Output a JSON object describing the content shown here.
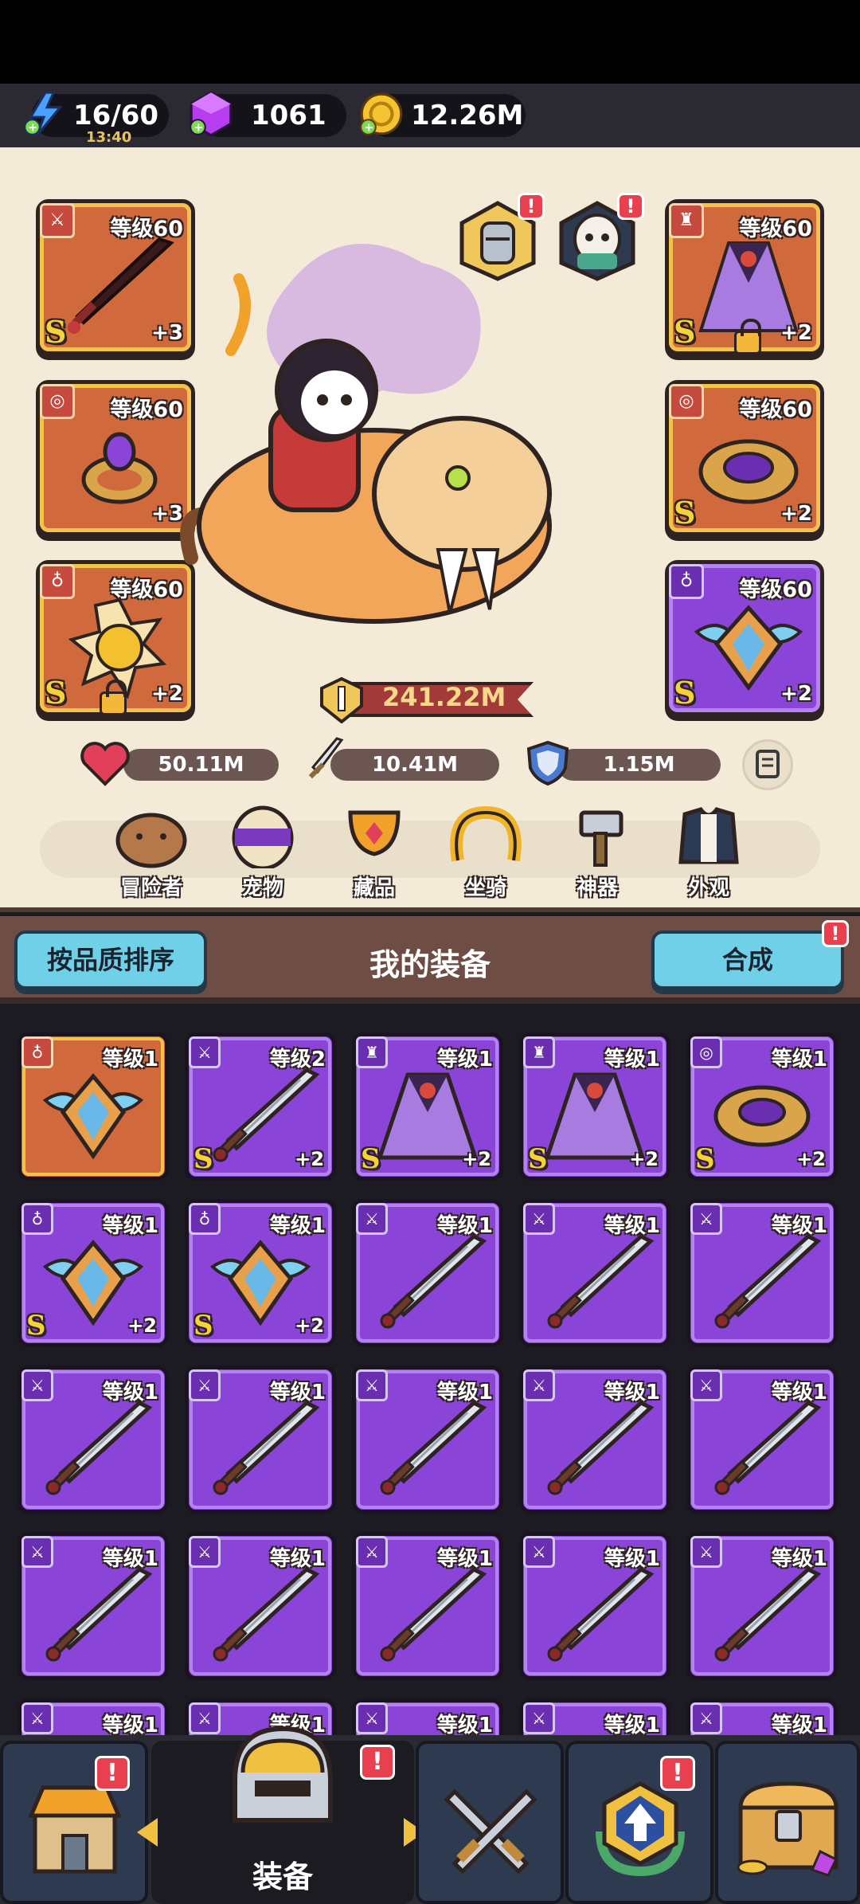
{
  "resources": {
    "energy": "16/60",
    "energy_timer": "13:40",
    "gems": "1061",
    "gold": "12.26M"
  },
  "equip_slots": [
    {
      "level": "等级60",
      "plus": "+3",
      "grade": "S",
      "type": "sword"
    },
    {
      "level": "等级60",
      "plus": "+3",
      "grade": "",
      "type": "ring"
    },
    {
      "level": "等级60",
      "plus": "+2",
      "grade": "S",
      "type": "necklace"
    },
    {
      "level": "等级60",
      "plus": "+2",
      "grade": "S",
      "type": "armor"
    },
    {
      "level": "等级60",
      "plus": "+2",
      "grade": "S",
      "type": "ring"
    },
    {
      "level": "等级60",
      "plus": "+2",
      "grade": "S",
      "type": "necklace"
    }
  ],
  "power": "241.22M",
  "stats": {
    "hp": "50.11M",
    "attack": "10.41M",
    "defense": "1.15M"
  },
  "tabs": [
    "冒险者",
    "宠物",
    "藏品",
    "坐骑",
    "神器",
    "外观"
  ],
  "toolbar": {
    "sort_label": "按品质排序",
    "title": "我的装备",
    "merge_label": "合成",
    "alert": "!"
  },
  "inventory": [
    {
      "level": "等级1",
      "plus": "",
      "grade": "",
      "type": "necklace",
      "color": "orange"
    },
    {
      "level": "等级2",
      "plus": "+2",
      "grade": "S",
      "type": "sword",
      "color": "purple"
    },
    {
      "level": "等级1",
      "plus": "+2",
      "grade": "S",
      "type": "armor",
      "color": "purple"
    },
    {
      "level": "等级1",
      "plus": "+2",
      "grade": "S",
      "type": "armor",
      "color": "purple"
    },
    {
      "level": "等级1",
      "plus": "+2",
      "grade": "S",
      "type": "ring",
      "color": "purple"
    },
    {
      "level": "等级1",
      "plus": "+2",
      "grade": "S",
      "type": "necklace",
      "color": "purple"
    },
    {
      "level": "等级1",
      "plus": "+2",
      "grade": "S",
      "type": "necklace",
      "color": "purple"
    },
    {
      "level": "等级1",
      "plus": "",
      "grade": "",
      "type": "sword",
      "color": "purple"
    },
    {
      "level": "等级1",
      "plus": "",
      "grade": "",
      "type": "sword",
      "color": "purple"
    },
    {
      "level": "等级1",
      "plus": "",
      "grade": "",
      "type": "sword",
      "color": "purple"
    },
    {
      "level": "等级1",
      "plus": "",
      "grade": "",
      "type": "sword",
      "color": "purple"
    },
    {
      "level": "等级1",
      "plus": "",
      "grade": "",
      "type": "sword",
      "color": "purple"
    },
    {
      "level": "等级1",
      "plus": "",
      "grade": "",
      "type": "sword",
      "color": "purple"
    },
    {
      "level": "等级1",
      "plus": "",
      "grade": "",
      "type": "sword",
      "color": "purple"
    },
    {
      "level": "等级1",
      "plus": "",
      "grade": "",
      "type": "sword",
      "color": "purple"
    },
    {
      "level": "等级1",
      "plus": "",
      "grade": "",
      "type": "sword",
      "color": "purple"
    },
    {
      "level": "等级1",
      "plus": "",
      "grade": "",
      "type": "sword",
      "color": "purple"
    },
    {
      "level": "等级1",
      "plus": "",
      "grade": "",
      "type": "sword",
      "color": "purple"
    },
    {
      "level": "等级1",
      "plus": "",
      "grade": "",
      "type": "sword",
      "color": "purple"
    },
    {
      "level": "等级1",
      "plus": "",
      "grade": "",
      "type": "sword",
      "color": "purple"
    },
    {
      "level": "等级1",
      "plus": "",
      "grade": "",
      "type": "sword",
      "color": "purple"
    },
    {
      "level": "等级1",
      "plus": "",
      "grade": "",
      "type": "sword",
      "color": "purple"
    },
    {
      "level": "等级1",
      "plus": "",
      "grade": "",
      "type": "sword",
      "color": "purple"
    },
    {
      "level": "等级1",
      "plus": "",
      "grade": "",
      "type": "sword",
      "color": "purple"
    },
    {
      "level": "等级1",
      "plus": "",
      "grade": "",
      "type": "sword",
      "color": "purple"
    }
  ],
  "nav": {
    "active_label": "装备",
    "alert": "!"
  }
}
